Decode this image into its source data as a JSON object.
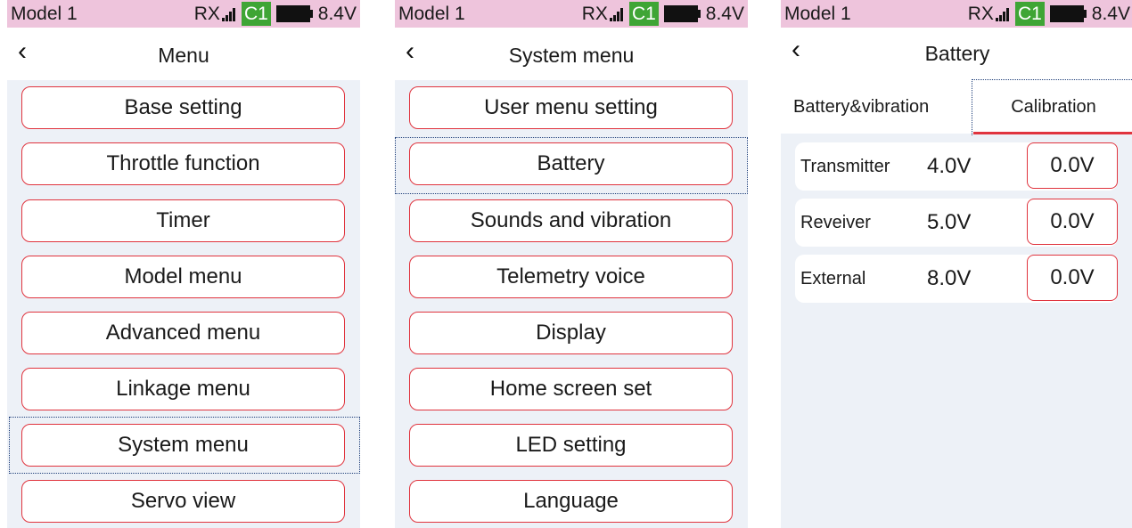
{
  "status": {
    "model": "Model 1",
    "rx": "RX",
    "channel": "C1",
    "voltage": "8.4V"
  },
  "screen1": {
    "title": "Menu",
    "items": [
      "Base setting",
      "Throttle function",
      "Timer",
      "Model menu",
      "Advanced menu",
      "Linkage menu",
      "System menu",
      "Servo view"
    ],
    "selected": "System menu"
  },
  "screen2": {
    "title": "System menu",
    "items": [
      "User menu setting",
      "Battery",
      "Sounds and vibration",
      "Telemetry voice",
      "Display",
      "Home screen set",
      "LED setting",
      "Language"
    ],
    "selected": "Battery"
  },
  "screen3": {
    "title": "Battery",
    "tabs": [
      "Battery&vibration",
      "Calibration"
    ],
    "active_tab": "Calibration",
    "rows": [
      {
        "label": "Transmitter",
        "value": "4.0V",
        "calibration": "0.0V"
      },
      {
        "label": "Reveiver",
        "value": "5.0V",
        "calibration": "0.0V"
      },
      {
        "label": "External",
        "value": "8.0V",
        "calibration": "0.0V"
      }
    ]
  },
  "colors": {
    "status_bg": "#eec4dc",
    "accent_red": "#e0343e",
    "channel_green": "#3fa535",
    "list_bg": "#edf1f7"
  }
}
